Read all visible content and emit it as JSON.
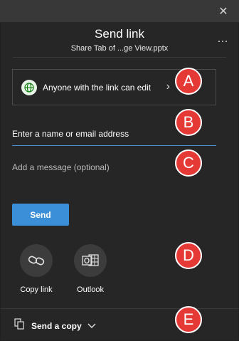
{
  "window": {
    "close_icon": "close-icon"
  },
  "header": {
    "title": "Send link",
    "subtitle": "Share Tab of ...ge View.pptx",
    "more_icon": "more-icon"
  },
  "permission": {
    "text": "Anyone with the link can edit",
    "icon": "globe-icon"
  },
  "recipient": {
    "placeholder": "Enter a name or email address"
  },
  "message": {
    "placeholder": "Add a message (optional)"
  },
  "send_button": {
    "label": "Send",
    "color": "#3a8fd8"
  },
  "share_options": [
    {
      "label": "Copy link",
      "icon": "link-icon"
    },
    {
      "label": "Outlook",
      "icon": "outlook-icon"
    }
  ],
  "footer": {
    "send_copy_label": "Send a copy",
    "icon": "copy-icon"
  },
  "annotations": [
    "A",
    "B",
    "C",
    "D",
    "E"
  ],
  "colors": {
    "badge": "#e53935",
    "accent": "#4f8fd6"
  }
}
